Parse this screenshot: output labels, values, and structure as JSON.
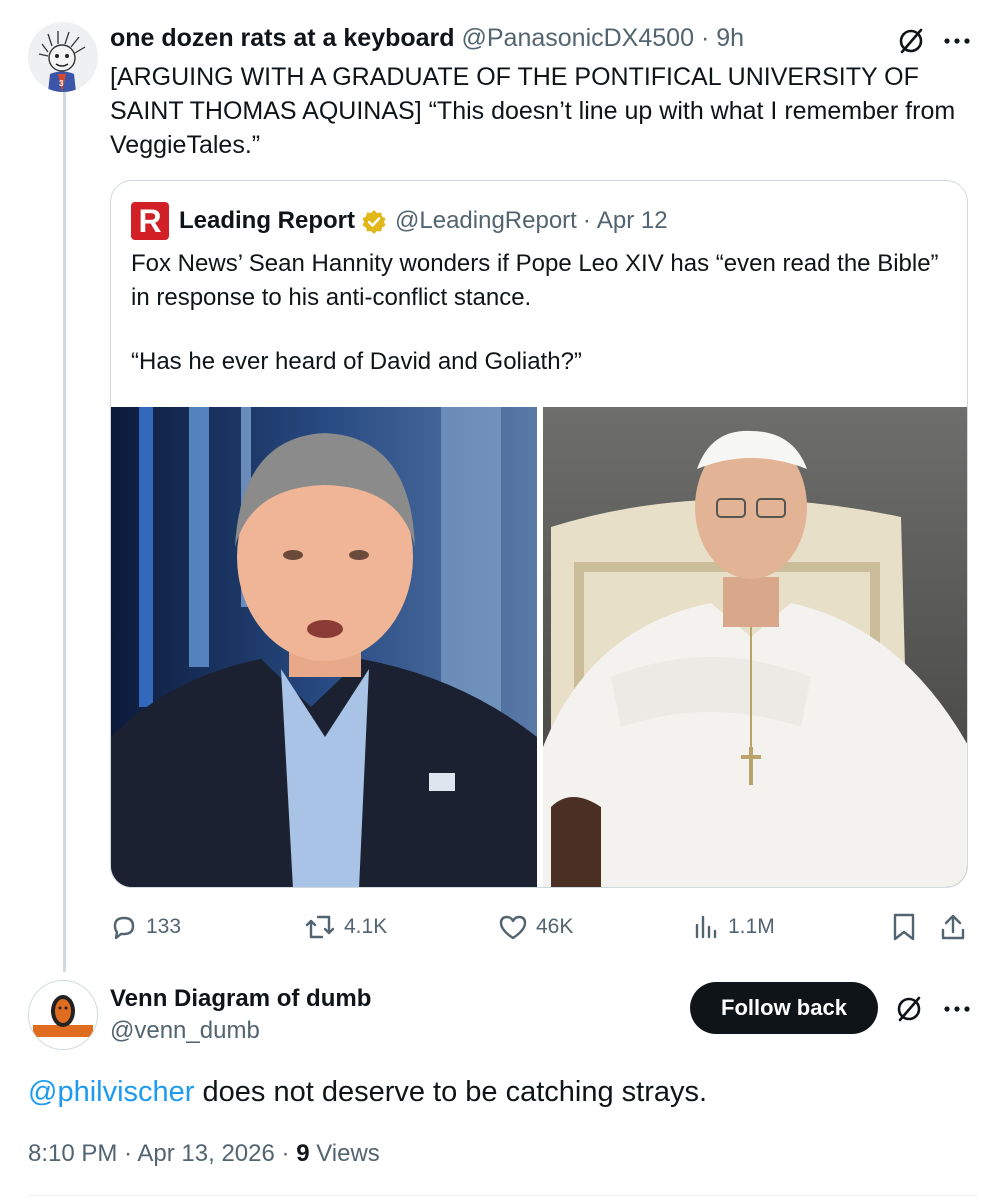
{
  "tweet": {
    "author_name": "one dozen rats at a keyboard",
    "author_handle": "@PanasonicDX4500",
    "time_ago": "9h",
    "text": "[ARGUING WITH A GRADUATE OF THE PONTIFICAL UNIVERSITY OF SAINT THOMAS AQUINAS] “This doesn’t line up with what I remember from VeggieTales.”",
    "icons": {
      "grok": "slash-circle-icon",
      "more": "more-dots-icon"
    }
  },
  "quoted": {
    "author_name": "Leading Report",
    "author_handle": "@LeadingReport",
    "date": "Apr 12",
    "logo_letter": "R",
    "line1": "Fox News’ Sean Hannity wonders if Pope Leo XIV has “even read the Bible” in response to his anti-conflict stance.",
    "line2": "“Has he ever heard of David and Goliath?”",
    "logo_color": "#d32027",
    "verified_color": "#e2b719"
  },
  "actions": {
    "replies": "133",
    "reposts": "4.1K",
    "likes": "46K",
    "views": "1.1M"
  },
  "reply": {
    "author_name": "Venn Diagram of dumb",
    "author_handle": "@venn_dumb",
    "follow_label": "Follow back",
    "mention": "@philvischer",
    "text": " does not deserve to be catching strays.",
    "time": "8:10 PM",
    "date": "Apr 13, 2026",
    "views_count": "9",
    "views_label": "Views"
  },
  "colors": {
    "text": "#0f1419",
    "muted": "#536471",
    "link": "#1d9bf0",
    "border": "#cfd9de"
  }
}
